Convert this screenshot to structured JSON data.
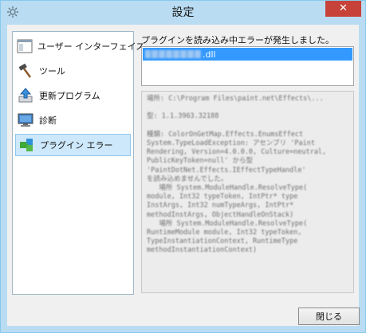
{
  "window": {
    "title": "設定",
    "close_glyph": "✕"
  },
  "sidebar": {
    "items": [
      {
        "label": "ユーザー インターフェイス",
        "icon": "window-icon",
        "selected": false
      },
      {
        "label": "ツール",
        "icon": "hammer-icon",
        "selected": false
      },
      {
        "label": "更新プログラム",
        "icon": "update-icon",
        "selected": false
      },
      {
        "label": "診断",
        "icon": "monitor-icon",
        "selected": false
      },
      {
        "label": "プラグイン エラー",
        "icon": "puzzle-icon",
        "selected": true
      }
    ]
  },
  "main": {
    "error_title": "プラグインを読み込み中エラーが発生しました。",
    "files": [
      {
        "name_suffix": ".dll"
      }
    ],
    "details": "場所: C:\\Program Files\\paint.net\\Effects\\...\n\n型: 1.1.3963.32188\n\n種類: ColorOnGetMap.Effects.EnumsEffect\nSystem.TypeLoadException: アセンブリ 'Paint\nRendering, Version=4.0.0.0, Culture=neutral,\nPublicKeyToken=null' から型\n'PaintDotNet.Effects.IEffectTypeHandle'\nを読み込めませんでした。\n   場所 System.ModuleHandle.ResolveType(\nmodule, Int32 typeToken, IntPtr* type\nInstArgs, Int32 numTypeArgs, IntPtr*\nmethodInstArgs, ObjectHandleOnStack)\n   場所 System.ModuleHandle.ResolveType(\nRuntimeModule module, Int32 typeToken,\nTypeInstantiationContext, RuntimeType\nmethodInstantiationContext)"
  },
  "footer": {
    "close_label": "閉じる"
  }
}
